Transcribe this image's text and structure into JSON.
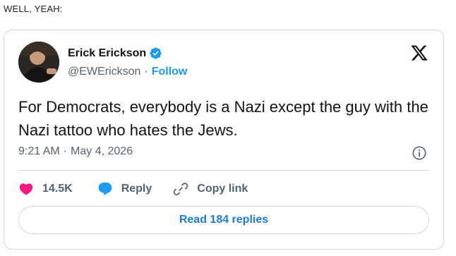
{
  "caption": "WELL, YEAH:",
  "tweet": {
    "author_name": "Erick Erickson",
    "handle": "@EWErickson",
    "separator": "·",
    "follow_label": "Follow",
    "text": "For Democrats, everybody is a Nazi except the guy with the Nazi tattoo who hates the Jews.",
    "time": "9:21 AM",
    "date": "May 4, 2026",
    "verified": true
  },
  "actions": {
    "likes": "14.5K",
    "reply_label": "Reply",
    "copy_link_label": "Copy link"
  },
  "read_replies_label": "Read 184 replies",
  "icons": {
    "verified": "verified-badge-icon",
    "logo": "x-logo-icon",
    "info": "info-icon",
    "like": "heart-icon",
    "reply": "speech-bubble-icon",
    "link": "link-icon"
  },
  "colors": {
    "accent": "#1d9bf0",
    "heart": "#f91880",
    "muted": "#536471",
    "border": "#cfd9de",
    "text": "#0f1419"
  }
}
